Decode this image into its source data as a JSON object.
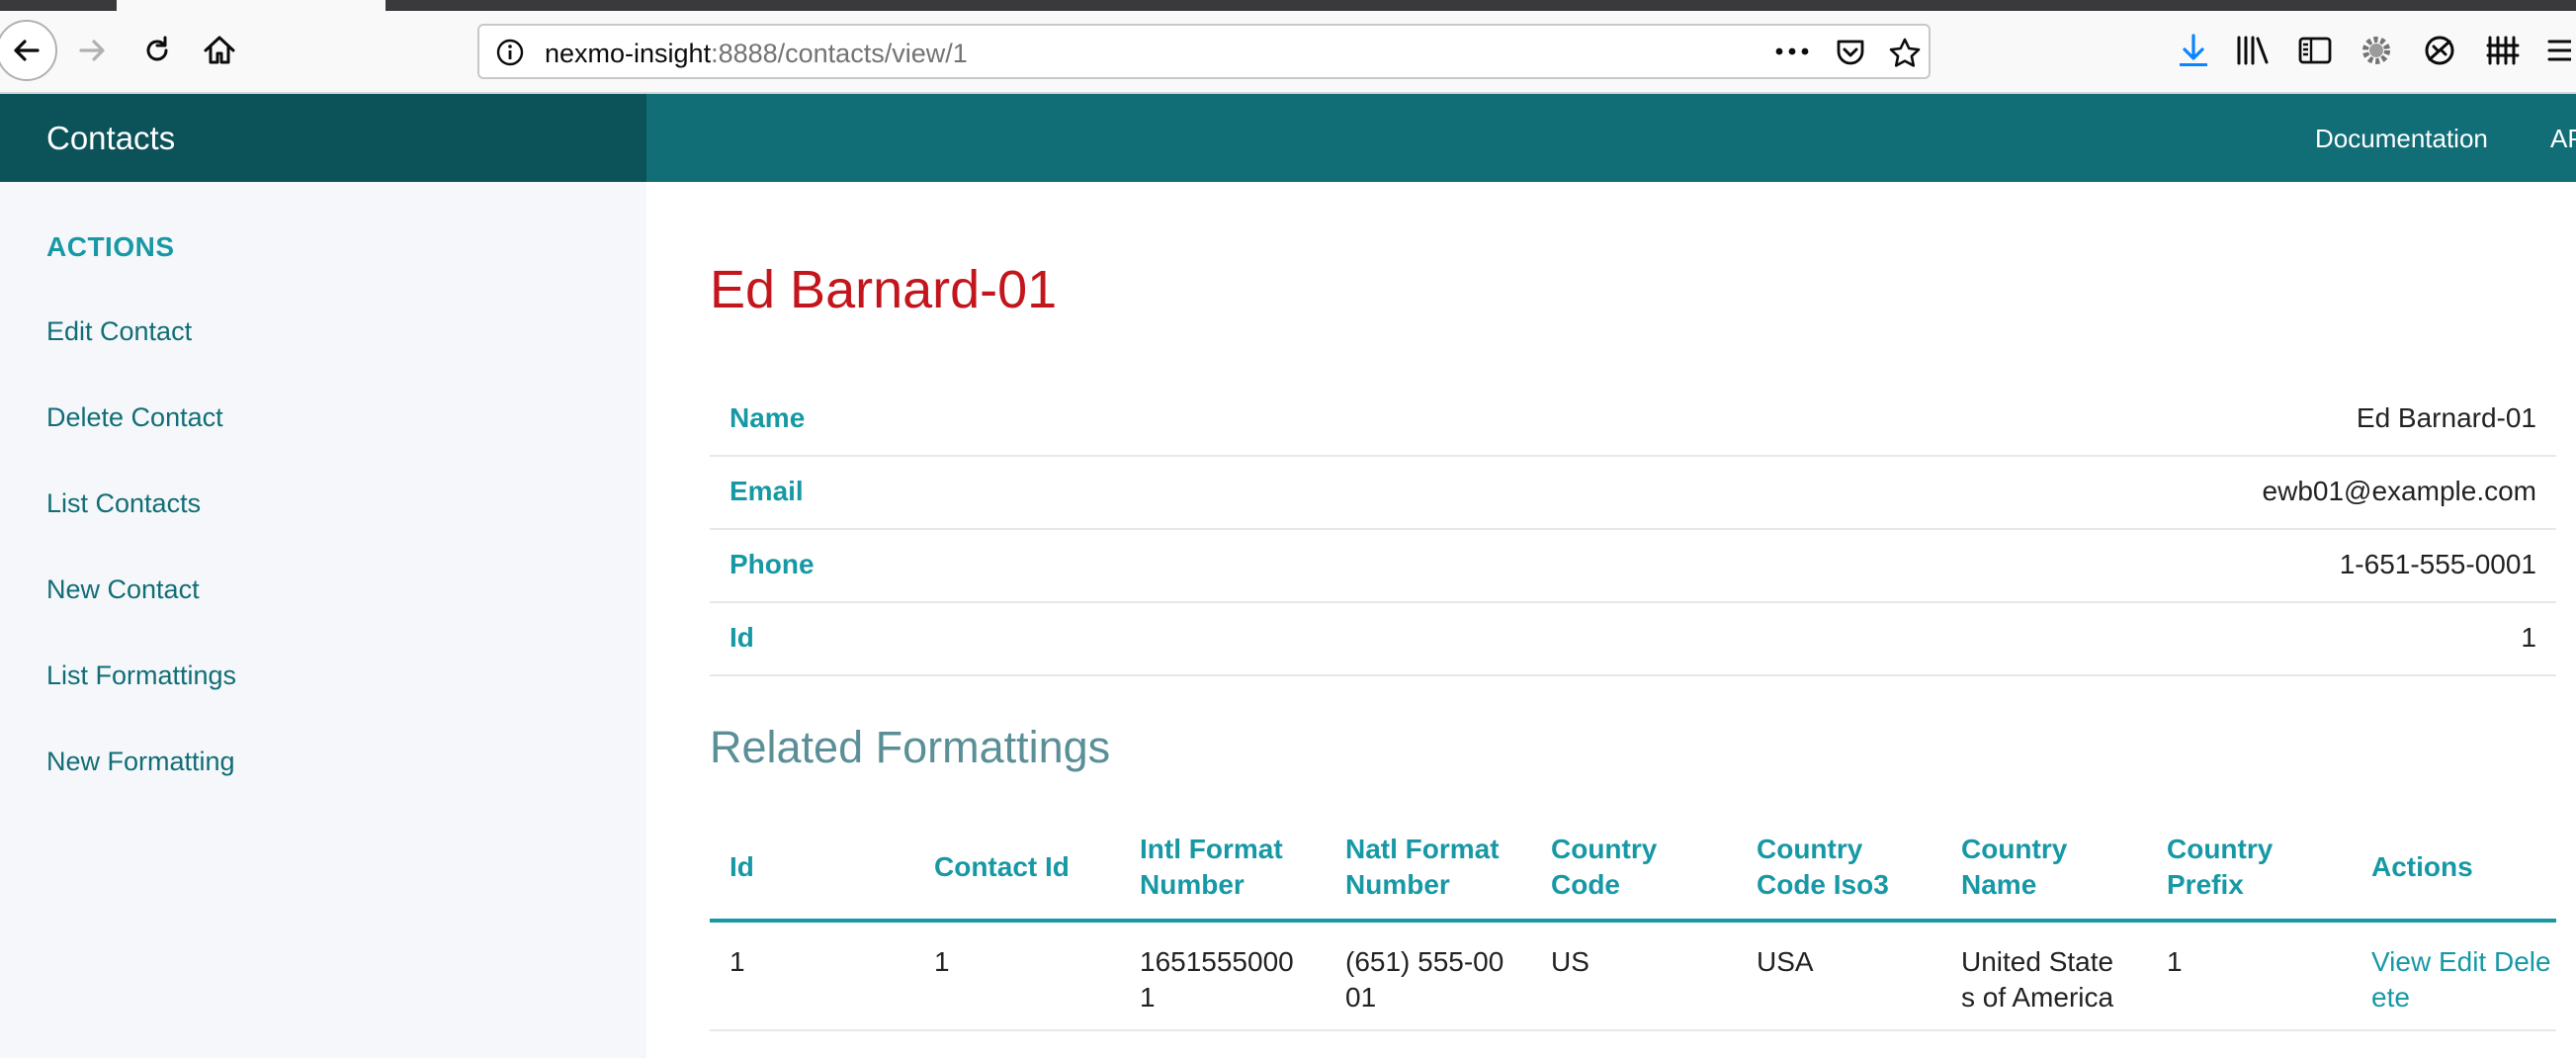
{
  "browser": {
    "url_host": "nexmo-insight",
    "url_path": ":8888/contacts/view/1",
    "icons": [
      "back-icon",
      "forward-icon",
      "reload-icon",
      "home-icon",
      "info-icon",
      "more-icon",
      "pocket-icon",
      "star-icon",
      "download-icon",
      "library-icon",
      "sidebar-icon",
      "extension-gear-icon",
      "extension-sync-icon",
      "extension-grid-icon",
      "menu-icon"
    ]
  },
  "header": {
    "brand": "Contacts",
    "nav": [
      "Documentation",
      "AP"
    ]
  },
  "sidebar": {
    "heading": "ACTIONS",
    "items": [
      "Edit Contact",
      "Delete Contact",
      "List Contacts",
      "New Contact",
      "List Formattings",
      "New Formatting"
    ]
  },
  "contact": {
    "title": "Ed Barnard-01",
    "fields": [
      {
        "label": "Name",
        "value": "Ed Barnard-01"
      },
      {
        "label": "Email",
        "value": "ewb01@example.com"
      },
      {
        "label": "Phone",
        "value": "1-651-555-0001"
      },
      {
        "label": "Id",
        "value": "1"
      }
    ]
  },
  "related": {
    "title": "Related Formattings",
    "headers": [
      [
        "Id"
      ],
      [
        "Contact Id"
      ],
      [
        "Intl Format",
        "Number"
      ],
      [
        "Natl Format",
        "Number"
      ],
      [
        "Country",
        "Code"
      ],
      [
        "Country",
        "Code Iso3"
      ],
      [
        "Country",
        "Name"
      ],
      [
        "Country",
        "Prefix"
      ],
      [
        "Actions"
      ]
    ],
    "row": {
      "id": "1",
      "contact_id": "1",
      "intl_format_number": [
        "1651555000",
        "1"
      ],
      "natl_format_number": [
        "(651) 555-00",
        "01"
      ],
      "country_code": "US",
      "country_code_iso3": "USA",
      "country_name": [
        "United State",
        "s of America"
      ],
      "country_prefix": "1",
      "actions": [
        "View Edit Dele",
        "ete"
      ]
    }
  },
  "colors": {
    "brand_dark": "#0b5359",
    "header_teal": "#116d76",
    "accent": "#1798a5",
    "title_red": "#c3151c",
    "sidebar_bg": "#f5f7fa"
  }
}
